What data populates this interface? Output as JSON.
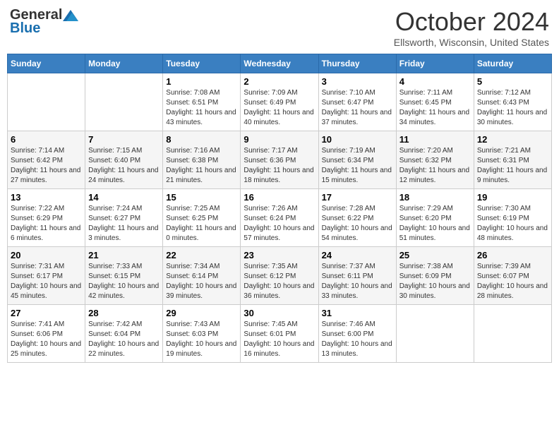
{
  "header": {
    "logo_general": "General",
    "logo_blue": "Blue",
    "month_title": "October 2024",
    "location": "Ellsworth, Wisconsin, United States"
  },
  "days_of_week": [
    "Sunday",
    "Monday",
    "Tuesday",
    "Wednesday",
    "Thursday",
    "Friday",
    "Saturday"
  ],
  "weeks": [
    [
      {
        "day": "",
        "info": ""
      },
      {
        "day": "",
        "info": ""
      },
      {
        "day": "1",
        "info": "Sunrise: 7:08 AM\nSunset: 6:51 PM\nDaylight: 11 hours and 43 minutes."
      },
      {
        "day": "2",
        "info": "Sunrise: 7:09 AM\nSunset: 6:49 PM\nDaylight: 11 hours and 40 minutes."
      },
      {
        "day": "3",
        "info": "Sunrise: 7:10 AM\nSunset: 6:47 PM\nDaylight: 11 hours and 37 minutes."
      },
      {
        "day": "4",
        "info": "Sunrise: 7:11 AM\nSunset: 6:45 PM\nDaylight: 11 hours and 34 minutes."
      },
      {
        "day": "5",
        "info": "Sunrise: 7:12 AM\nSunset: 6:43 PM\nDaylight: 11 hours and 30 minutes."
      }
    ],
    [
      {
        "day": "6",
        "info": "Sunrise: 7:14 AM\nSunset: 6:42 PM\nDaylight: 11 hours and 27 minutes."
      },
      {
        "day": "7",
        "info": "Sunrise: 7:15 AM\nSunset: 6:40 PM\nDaylight: 11 hours and 24 minutes."
      },
      {
        "day": "8",
        "info": "Sunrise: 7:16 AM\nSunset: 6:38 PM\nDaylight: 11 hours and 21 minutes."
      },
      {
        "day": "9",
        "info": "Sunrise: 7:17 AM\nSunset: 6:36 PM\nDaylight: 11 hours and 18 minutes."
      },
      {
        "day": "10",
        "info": "Sunrise: 7:19 AM\nSunset: 6:34 PM\nDaylight: 11 hours and 15 minutes."
      },
      {
        "day": "11",
        "info": "Sunrise: 7:20 AM\nSunset: 6:32 PM\nDaylight: 11 hours and 12 minutes."
      },
      {
        "day": "12",
        "info": "Sunrise: 7:21 AM\nSunset: 6:31 PM\nDaylight: 11 hours and 9 minutes."
      }
    ],
    [
      {
        "day": "13",
        "info": "Sunrise: 7:22 AM\nSunset: 6:29 PM\nDaylight: 11 hours and 6 minutes."
      },
      {
        "day": "14",
        "info": "Sunrise: 7:24 AM\nSunset: 6:27 PM\nDaylight: 11 hours and 3 minutes."
      },
      {
        "day": "15",
        "info": "Sunrise: 7:25 AM\nSunset: 6:25 PM\nDaylight: 11 hours and 0 minutes."
      },
      {
        "day": "16",
        "info": "Sunrise: 7:26 AM\nSunset: 6:24 PM\nDaylight: 10 hours and 57 minutes."
      },
      {
        "day": "17",
        "info": "Sunrise: 7:28 AM\nSunset: 6:22 PM\nDaylight: 10 hours and 54 minutes."
      },
      {
        "day": "18",
        "info": "Sunrise: 7:29 AM\nSunset: 6:20 PM\nDaylight: 10 hours and 51 minutes."
      },
      {
        "day": "19",
        "info": "Sunrise: 7:30 AM\nSunset: 6:19 PM\nDaylight: 10 hours and 48 minutes."
      }
    ],
    [
      {
        "day": "20",
        "info": "Sunrise: 7:31 AM\nSunset: 6:17 PM\nDaylight: 10 hours and 45 minutes."
      },
      {
        "day": "21",
        "info": "Sunrise: 7:33 AM\nSunset: 6:15 PM\nDaylight: 10 hours and 42 minutes."
      },
      {
        "day": "22",
        "info": "Sunrise: 7:34 AM\nSunset: 6:14 PM\nDaylight: 10 hours and 39 minutes."
      },
      {
        "day": "23",
        "info": "Sunrise: 7:35 AM\nSunset: 6:12 PM\nDaylight: 10 hours and 36 minutes."
      },
      {
        "day": "24",
        "info": "Sunrise: 7:37 AM\nSunset: 6:11 PM\nDaylight: 10 hours and 33 minutes."
      },
      {
        "day": "25",
        "info": "Sunrise: 7:38 AM\nSunset: 6:09 PM\nDaylight: 10 hours and 30 minutes."
      },
      {
        "day": "26",
        "info": "Sunrise: 7:39 AM\nSunset: 6:07 PM\nDaylight: 10 hours and 28 minutes."
      }
    ],
    [
      {
        "day": "27",
        "info": "Sunrise: 7:41 AM\nSunset: 6:06 PM\nDaylight: 10 hours and 25 minutes."
      },
      {
        "day": "28",
        "info": "Sunrise: 7:42 AM\nSunset: 6:04 PM\nDaylight: 10 hours and 22 minutes."
      },
      {
        "day": "29",
        "info": "Sunrise: 7:43 AM\nSunset: 6:03 PM\nDaylight: 10 hours and 19 minutes."
      },
      {
        "day": "30",
        "info": "Sunrise: 7:45 AM\nSunset: 6:01 PM\nDaylight: 10 hours and 16 minutes."
      },
      {
        "day": "31",
        "info": "Sunrise: 7:46 AM\nSunset: 6:00 PM\nDaylight: 10 hours and 13 minutes."
      },
      {
        "day": "",
        "info": ""
      },
      {
        "day": "",
        "info": ""
      }
    ]
  ]
}
